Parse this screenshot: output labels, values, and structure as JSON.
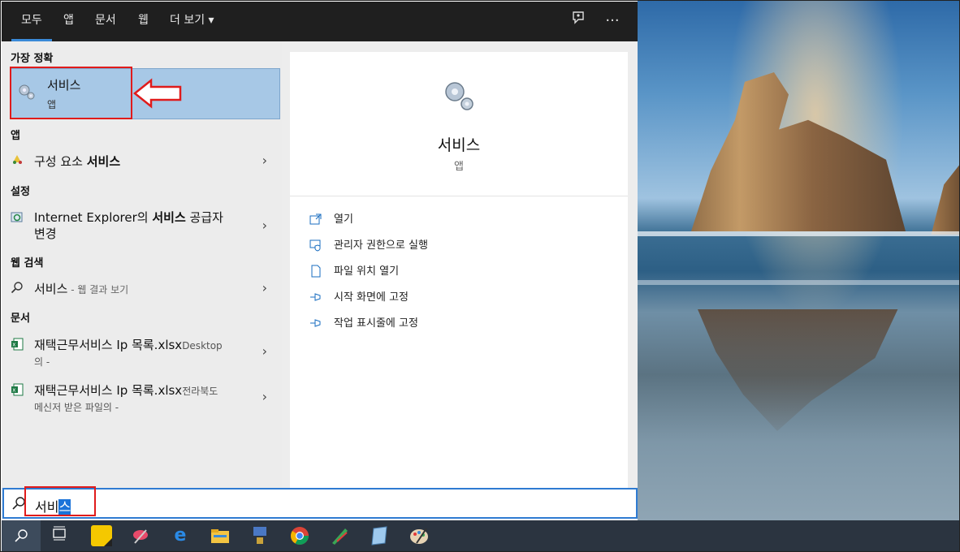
{
  "topbar": {
    "tabs": [
      {
        "label": "모두",
        "active": true
      },
      {
        "label": "앱"
      },
      {
        "label": "문서"
      },
      {
        "label": "웹"
      },
      {
        "label": "더 보기"
      }
    ],
    "more_chevron": "▾",
    "feedback_icon": "feedback-icon",
    "options_label": "···"
  },
  "best_match": {
    "header": "가장 정확",
    "title": "서비스",
    "subtitle": "앱",
    "icon": "gears-icon"
  },
  "apps": {
    "header": "앱",
    "items": [
      {
        "label_prefix": "구성 요소 ",
        "label_bold": "서비스",
        "icon": "component-services-icon"
      }
    ]
  },
  "settings": {
    "header": "설정",
    "items": [
      {
        "line1_prefix": "Internet Explorer의 ",
        "line1_bold": "서비스",
        "line1_suffix": " 공급자",
        "line2": "변경",
        "icon": "ie-settings-icon"
      }
    ]
  },
  "web": {
    "header": "웹 검색",
    "items": [
      {
        "label": "서비스",
        "suffix": " - 웹 결과 보기",
        "icon": "search-icon"
      }
    ]
  },
  "docs": {
    "header": "문서",
    "items": [
      {
        "title": "재택근무서비스 Ip 목록.xlsx",
        "location_inline": "Desktop",
        "line2": "의 -"
      },
      {
        "title": "재택근무서비스 Ip 목록.xlsx",
        "location_inline": "전라북도",
        "line2": "메신저 받은 파일의 -"
      }
    ]
  },
  "preview": {
    "title": "서비스",
    "subtitle": "앱",
    "actions": [
      {
        "label": "열기",
        "icon": "open-icon"
      },
      {
        "label": "관리자 권한으로 실행",
        "icon": "shield-icon"
      },
      {
        "label": "파일 위치 열기",
        "icon": "file-location-icon"
      },
      {
        "label": "시작 화면에 고정",
        "icon": "pin-icon"
      },
      {
        "label": "작업 표시줄에 고정",
        "icon": "pin-icon"
      }
    ]
  },
  "search": {
    "typed": "서비",
    "selected": "스"
  },
  "taskbar": {
    "icons": [
      "search-icon",
      "task-view-icon",
      "sticky-notes-icon",
      "snipping-tool-icon",
      "internet-explorer-icon",
      "file-explorer-icon",
      "network-icon",
      "chrome-icon",
      "pen-app-icon",
      "notepad-icon",
      "paint-icon"
    ]
  },
  "colors": {
    "accent": "#3a8ad8",
    "selection": "#a7c8e6",
    "annotation": "#e01b1b"
  }
}
